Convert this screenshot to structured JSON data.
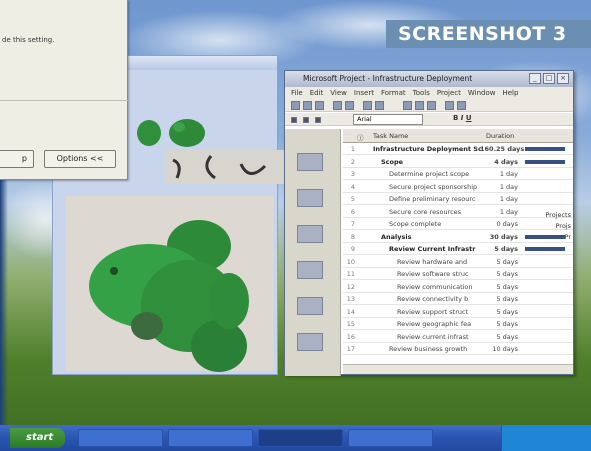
{
  "overlay_label": "SCREENSHOT 3",
  "dialog": {
    "help_text": "de this setting.",
    "buttons": [
      {
        "label": "p"
      },
      {
        "label": "Options <<"
      }
    ]
  },
  "project": {
    "title": "Microsoft Project - Infrastructure Deployment",
    "menu": [
      "File",
      "Edit",
      "View",
      "Insert",
      "Format",
      "Tools",
      "Project",
      "Window",
      "Help"
    ],
    "font_box": "Arial",
    "columns": {
      "id": "",
      "info": "",
      "task_name": "Task Name",
      "duration": "Duration"
    },
    "rows": [
      {
        "id": "1",
        "name": "Infrastructure Deployment Sc",
        "duration": "160.25 days",
        "level": 0,
        "summary": true
      },
      {
        "id": "2",
        "name": "Scope",
        "duration": "4 days",
        "level": 1,
        "summary": true
      },
      {
        "id": "3",
        "name": "Determine project scope",
        "duration": "1 day",
        "level": 2,
        "summary": false
      },
      {
        "id": "4",
        "name": "Secure project sponsorship",
        "duration": "1 day",
        "level": 2,
        "summary": false
      },
      {
        "id": "5",
        "name": "Define preliminary resourc",
        "duration": "1 day",
        "level": 2,
        "summary": false
      },
      {
        "id": "6",
        "name": "Secure core resources",
        "duration": "1 day",
        "level": 2,
        "summary": false
      },
      {
        "id": "7",
        "name": "Scope complete",
        "duration": "0 days",
        "level": 2,
        "summary": false
      },
      {
        "id": "8",
        "name": "Analysis",
        "duration": "30 days",
        "level": 1,
        "summary": true
      },
      {
        "id": "9",
        "name": "Review Current Infrastr",
        "duration": "5 days",
        "level": 2,
        "summary": true
      },
      {
        "id": "10",
        "name": "Review hardware and",
        "duration": "5 days",
        "level": 3,
        "summary": false
      },
      {
        "id": "11",
        "name": "Review software struc",
        "duration": "5 days",
        "level": 3,
        "summary": false
      },
      {
        "id": "12",
        "name": "Review communication",
        "duration": "5 days",
        "level": 3,
        "summary": false
      },
      {
        "id": "13",
        "name": "Review connectivity b",
        "duration": "5 days",
        "level": 3,
        "summary": false
      },
      {
        "id": "14",
        "name": "Review support struct",
        "duration": "5 days",
        "level": 3,
        "summary": false
      },
      {
        "id": "15",
        "name": "Review geographic fea",
        "duration": "5 days",
        "level": 3,
        "summary": false
      },
      {
        "id": "16",
        "name": "Review current infrast",
        "duration": "5 days",
        "level": 3,
        "summary": false
      },
      {
        "id": "17",
        "name": "Review business growth",
        "duration": "10 days",
        "level": 2,
        "summary": false
      }
    ],
    "gantt_labels": [
      "Projects",
      "Projs",
      "Pr"
    ]
  },
  "taskbar": {
    "start_label": "start",
    "tasks": [
      "",
      "",
      "",
      ""
    ]
  },
  "colors": {
    "taskbar": "#2b56b2",
    "label_bg": "#6b8fb2",
    "frog_green": "#2f8f3a"
  }
}
